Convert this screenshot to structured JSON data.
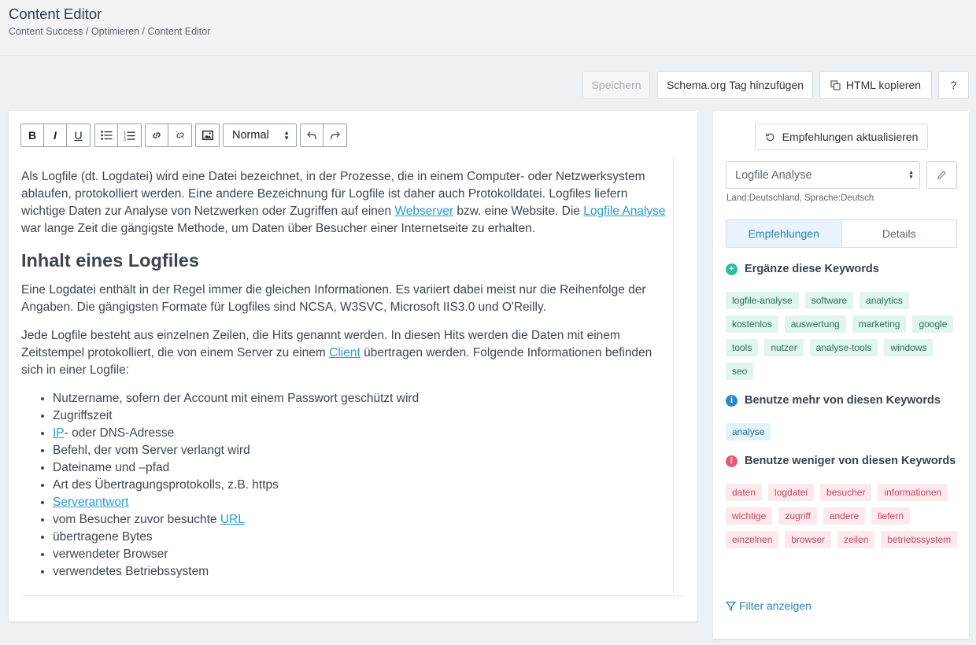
{
  "header": {
    "title": "Content Editor",
    "breadcrumb": [
      "Content Success",
      "Optimieren",
      "Content Editor"
    ]
  },
  "actions": {
    "save": "Speichern",
    "schema": "Schema.org Tag hinzufügen",
    "copy_html": "HTML kopieren",
    "help": "?"
  },
  "toolbar": {
    "format_select": "Normal",
    "buttons": [
      "bold",
      "italic",
      "underline",
      "bullet-list",
      "numbered-list",
      "link",
      "unlink",
      "image",
      "undo",
      "redo"
    ]
  },
  "editor": {
    "p1": {
      "t1": "Als Logfile (dt. Logdatei) wird eine Datei bezeichnet, in der Prozesse, die in einem Computer- oder Netzwerksystem ablaufen, protokolliert werden. Eine andere Bezeichnung für Logfile ist daher auch Protokolldatei. Logfiles liefern wichtige Daten zur Analyse von Netzwerken oder Zugriffen auf einen ",
      "link1": "Webserver",
      "t2": " bzw. eine Website. Die ",
      "link2": "Logfile Analyse",
      "t3": " war lange Zeit die gängigste Methode, um Daten über Besucher einer Internetseite zu erhalten."
    },
    "heading": "Inhalt eines Logfiles",
    "p2": "Eine Logdatei enthält in der Regel immer die gleichen Informationen. Es variiert dabei meist nur die Reihenfolge der Angaben. Die gängigsten Formate für Logfiles sind NCSA, W3SVC, Microsoft IIS3.0 und O'Reilly.",
    "p3": {
      "t1": "Jede Logfile besteht aus einzelnen Zeilen, die Hits genannt werden. In diesen Hits werden die Daten mit einem Zeitstempel protokolliert, die von einem Server zu einem ",
      "link": "Client",
      "t2": " übertragen werden. Folgende Informationen befinden sich in einer Logfile:"
    },
    "list": {
      "i1": "Nutzername, sofern der Account mit einem Passwort geschützt wird",
      "i2": "Zugriffszeit",
      "i3_link": "IP",
      "i3_text": "- oder DNS-Adresse",
      "i4": "Befehl, der vom Server verlangt wird",
      "i5": "Dateiname und –pfad",
      "i6": "Art des Übertragungsprotokolls, z.B. https",
      "i7_link": "Serverantwort",
      "i8_text": "vom Besucher zuvor besuchte ",
      "i8_link": "URL",
      "i9": "übertragene Bytes",
      "i10": "verwendeter Browser",
      "i11": "verwendetes Betriebssystem"
    }
  },
  "sidebar": {
    "refresh": "Empfehlungen aktualisieren",
    "keyword": "Logfile Analyse",
    "locale": "Land:Deutschland, Sprache:Deutsch",
    "tabs": [
      "Empfehlungen",
      "Details"
    ],
    "add_title": "Ergänze diese Keywords",
    "add_keywords": [
      "logfile-analyse",
      "software",
      "analytics",
      "kostenlos",
      "auswertung",
      "marketing",
      "google",
      "tools",
      "nutzer",
      "analyse-tools",
      "windows",
      "seo"
    ],
    "more_title": "Benutze mehr von diesen Keywords",
    "more_keywords": [
      "analyse"
    ],
    "less_title": "Benutze weniger von diesen Keywords",
    "less_keywords": [
      "daten",
      "logdatei",
      "besucher",
      "informationen",
      "wichtige",
      "zugriff",
      "andere",
      "liefern",
      "einzelnen",
      "browser",
      "zeilen",
      "betriebssystem"
    ],
    "filter": "Filter anzeigen"
  },
  "colors": {
    "link": "#2c9ad1",
    "accent": "#2c7fb8",
    "add_icon": "#2fbf9a",
    "more_icon": "#2c88c8",
    "less_icon": "#e65b78"
  }
}
